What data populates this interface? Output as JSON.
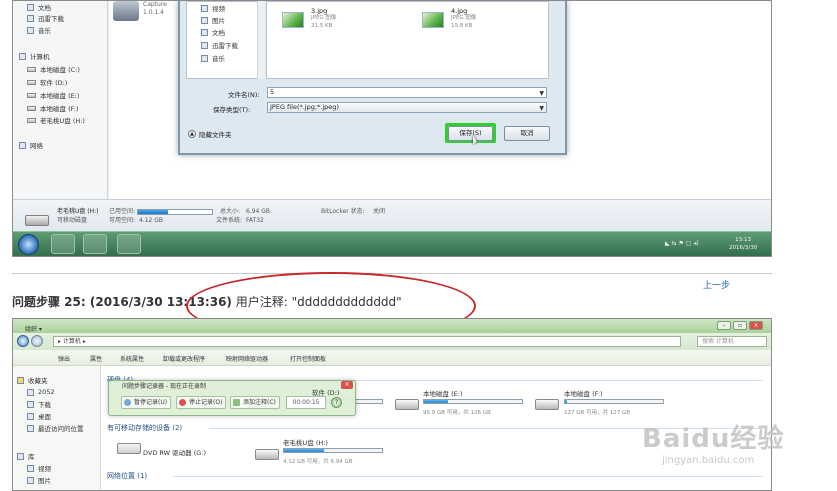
{
  "top_screenshot": {
    "nav": {
      "items": [
        {
          "label": "文档",
          "icon": "document-icon"
        },
        {
          "label": "迅雷下载",
          "icon": "folder-icon"
        },
        {
          "label": "音乐",
          "icon": "music-icon"
        },
        {
          "label": "计算机",
          "icon": "computer-icon"
        },
        {
          "label": "本地磁盘 (C:)",
          "icon": "drive-icon"
        },
        {
          "label": "软件 (D:)",
          "icon": "drive-icon"
        },
        {
          "label": "本地磁盘 (E:)",
          "icon": "drive-icon"
        },
        {
          "label": "本地磁盘 (F:)",
          "icon": "drive-icon"
        },
        {
          "label": "老毛桃U盘 (H:)",
          "icon": "usb-drive-icon"
        },
        {
          "label": "网络",
          "icon": "network-icon"
        }
      ]
    },
    "app_item": {
      "name": "Capture",
      "line2": "1.0.1.4"
    },
    "save_dialog": {
      "folder_tree": [
        {
          "label": "视频",
          "icon": "video-icon"
        },
        {
          "label": "图片",
          "icon": "picture-icon"
        },
        {
          "label": "文档",
          "icon": "document-icon"
        },
        {
          "label": "迅雷下载",
          "icon": "folder-icon"
        },
        {
          "label": "音乐",
          "icon": "music-icon"
        }
      ],
      "files": [
        {
          "name": "3.jpg",
          "type": "JPEG 图像",
          "size": "21.5 KB"
        },
        {
          "name": "4.jpg",
          "type": "JPEG 图像",
          "size": "19.8 KB"
        }
      ],
      "filename_label": "文件名(N):",
      "filename_value": "5",
      "savetype_label": "保存类型(T):",
      "savetype_value": "JPEG file(*.jpg;*.jpeg)",
      "hide_folders": "隐藏文件夹",
      "save_button": "保存(S)",
      "cancel_button": "取消"
    },
    "status": {
      "device_name": "老毛桃U盘 (H:)",
      "device_type": "可移动磁盘",
      "used_label": "已用空间:",
      "free_label": "可用空间:",
      "free_value": "4.12 GB",
      "total_label": "总大小:",
      "total_value": "6.94 GB",
      "fs_label": "文件系统:",
      "fs_value": "FAT32",
      "bitlocker_label": "BitLocker 状态:",
      "bitlocker_value": "关闭",
      "used_fraction": 0.41
    },
    "taskbar": {
      "time": "13:13",
      "date": "2016/3/30"
    }
  },
  "prev_step_link": "上一步",
  "step_header": {
    "prefix": "问题步骤 25: (2016/3/30 13:13:36)",
    "note_label": "用户注释:",
    "note_value": "\"ddddddddddddd\""
  },
  "bottom_screenshot": {
    "address": "▸ 计算机 ▸",
    "search_placeholder": "搜索 计算机",
    "commands": [
      "组织 ▾",
      "弹出",
      "属性",
      "系统属性",
      "卸载或更改程序",
      "映射网络驱动器",
      "打开控制面板"
    ],
    "nav": [
      {
        "label": "收藏夹",
        "icon": "star-icon"
      },
      {
        "label": "2052",
        "icon": "folder-icon"
      },
      {
        "label": "下载",
        "icon": "download-icon"
      },
      {
        "label": "桌面",
        "icon": "desktop-icon"
      },
      {
        "label": "最近访问的位置",
        "icon": "recent-icon"
      },
      {
        "label": "库",
        "icon": "library-icon"
      },
      {
        "label": "视频",
        "icon": "video-icon"
      },
      {
        "label": "图片",
        "icon": "picture-icon"
      }
    ],
    "sections": {
      "hard_drives": "硬盘 (4)",
      "removable": "有可移动存储的设备 (2)",
      "network": "网络位置 (1)"
    },
    "drives": [
      {
        "name": "软件 (D:)",
        "sub": "",
        "fraction": 0.3
      },
      {
        "name": "本地磁盘 (E:)",
        "sub": "95.9 GB 可用，共 126 GB",
        "fraction": 0.24
      },
      {
        "name": "本地磁盘 (F:)",
        "sub": "127 GB 可用，共 127 GB",
        "fraction": 0.02
      }
    ],
    "dvd": {
      "name": "DVD RW 驱动器 (G:)"
    },
    "usb": {
      "name": "老毛桃U盘 (H:)",
      "sub": "4.12 GB 可用，共 6.94 GB",
      "fraction": 0.41
    },
    "recorder": {
      "title": "问题步骤记录器 - 现在正在录制",
      "pause": "暂停记录(U)",
      "stop": "停止记录(O)",
      "add_note": "添加注释(C)",
      "timer": "00:00:15"
    }
  },
  "watermark": {
    "main": "Baidu经验",
    "sub": "jingyan.baidu.com"
  }
}
